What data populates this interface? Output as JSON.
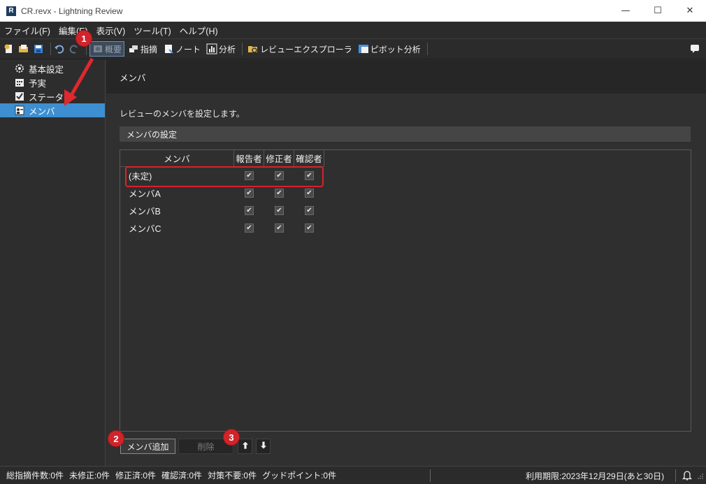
{
  "window": {
    "logo_letter": "R",
    "title": "CR.revx  - Lightning Review",
    "controls": {
      "minimize": "—",
      "maximize": "☐",
      "close": "✕"
    }
  },
  "menu": [
    "ファイル(F)",
    "編集(E)",
    "表示(V)",
    "ツール(T)",
    "ヘルプ(H)"
  ],
  "toolbar": {
    "overview": "概要",
    "findings": "指摘",
    "note": "ノート",
    "analysis": "分析",
    "review_explorer": "レビューエクスプローラ",
    "pivot_analysis": "ピボット分析"
  },
  "sidebar": {
    "items": [
      {
        "label": "基本設定",
        "icon": "gear-icon"
      },
      {
        "label": "予実",
        "icon": "calendar-icon"
      },
      {
        "label": "ステータス",
        "icon": "status-check-icon"
      },
      {
        "label": "メンバ",
        "icon": "member-card-icon",
        "selected": true
      }
    ]
  },
  "main": {
    "page_title": "メンバ",
    "description": "レビューのメンバを設定します。",
    "section_title": "メンバの設定",
    "grid": {
      "columns": [
        "メンバ",
        "報告者",
        "修正者",
        "確認者"
      ],
      "rows": [
        {
          "name": "(未定)",
          "reporter": true,
          "fixer": true,
          "confirmer": true
        },
        {
          "name": "メンバA",
          "reporter": true,
          "fixer": true,
          "confirmer": true
        },
        {
          "name": "メンバB",
          "reporter": true,
          "fixer": true,
          "confirmer": true
        },
        {
          "name": "メンバC",
          "reporter": true,
          "fixer": true,
          "confirmer": true
        }
      ]
    },
    "buttons": {
      "add": "メンバ追加",
      "delete": "削除",
      "up": "↑",
      "down": "↓"
    }
  },
  "callouts": [
    "1",
    "2",
    "3"
  ],
  "status": {
    "items": [
      "総指摘件数:0件",
      "未修正:0件",
      "修正済:0件",
      "確認済:0件",
      "対策不要:0件",
      "グッドポイント:0件"
    ],
    "expiry": "利用期限:2023年12月29日(あと30日)"
  },
  "colors": {
    "accent": "#3d8fd1",
    "callout": "#d0242b",
    "highlight": "#d8222a"
  }
}
